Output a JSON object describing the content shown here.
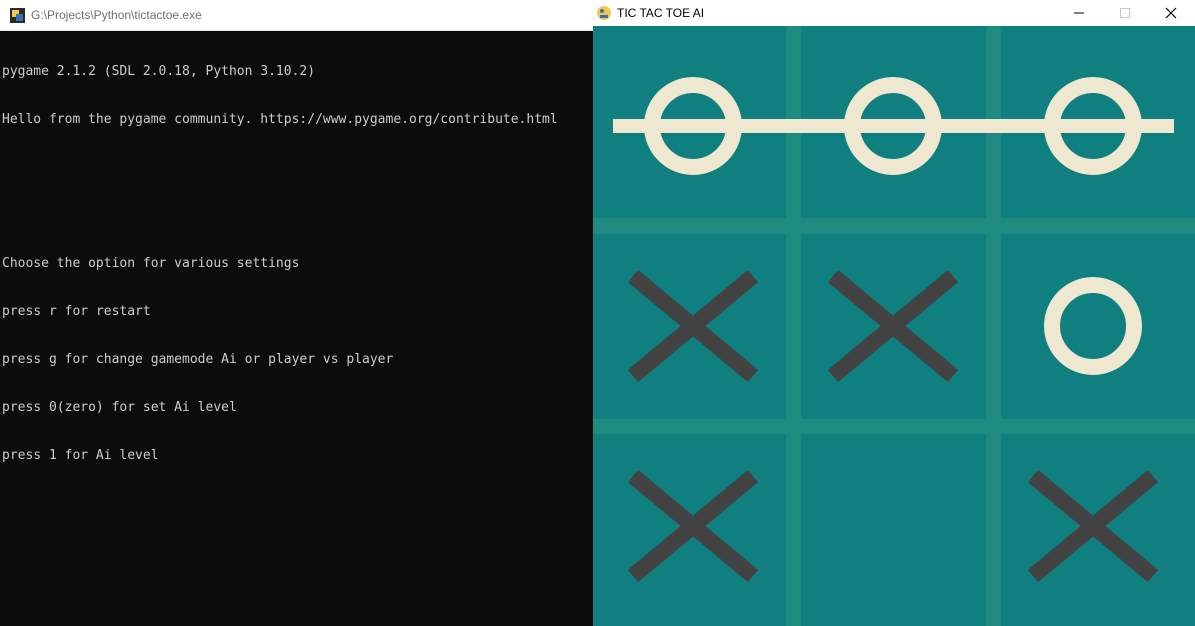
{
  "console": {
    "title": "G:\\Projects\\Python\\tictactoe.exe",
    "lines": [
      "pygame 2.1.2 (SDL 2.0.18, Python 3.10.2)",
      "Hello from the pygame community. https://www.pygame.org/contribute.html",
      "",
      "",
      "Choose the option for various settings",
      "press r for restart",
      "press g for change gamemode Ai or player vs player",
      "press 0(zero) for set Ai level",
      "press 1 for Ai level"
    ]
  },
  "game": {
    "title": "TIC TAC TOE AI",
    "board": [
      [
        "O",
        "O",
        "O"
      ],
      [
        "X",
        "X",
        "O"
      ],
      [
        "X",
        "",
        "X"
      ]
    ],
    "winning_row": 0,
    "colors": {
      "board_bg": "#0f807f",
      "grid_lines": "#1f8b80",
      "o_mark": "#efe8d1",
      "x_mark": "#424242"
    }
  }
}
